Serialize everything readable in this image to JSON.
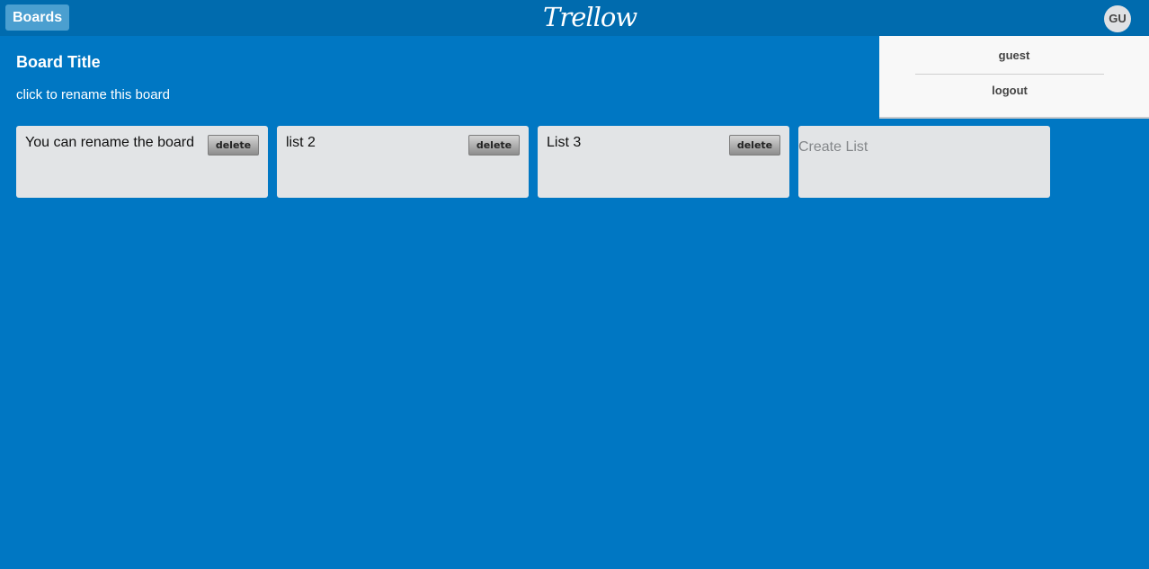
{
  "header": {
    "boards_label": "Boards",
    "logo_text": "Trellow",
    "avatar_initials": "GU"
  },
  "user_menu": {
    "username": "guest",
    "logout_label": "logout"
  },
  "board": {
    "title": "Board Title",
    "hint": "click to rename this board"
  },
  "lists": [
    {
      "title": "You can rename the board",
      "delete_label": "delete"
    },
    {
      "title": "list 2",
      "delete_label": "delete"
    },
    {
      "title": "List 3",
      "delete_label": "delete"
    }
  ],
  "create_list": {
    "placeholder": "Create List"
  },
  "colors": {
    "background": "#0077c3",
    "header": "#006bae",
    "list_background": "#e2e4e6"
  }
}
